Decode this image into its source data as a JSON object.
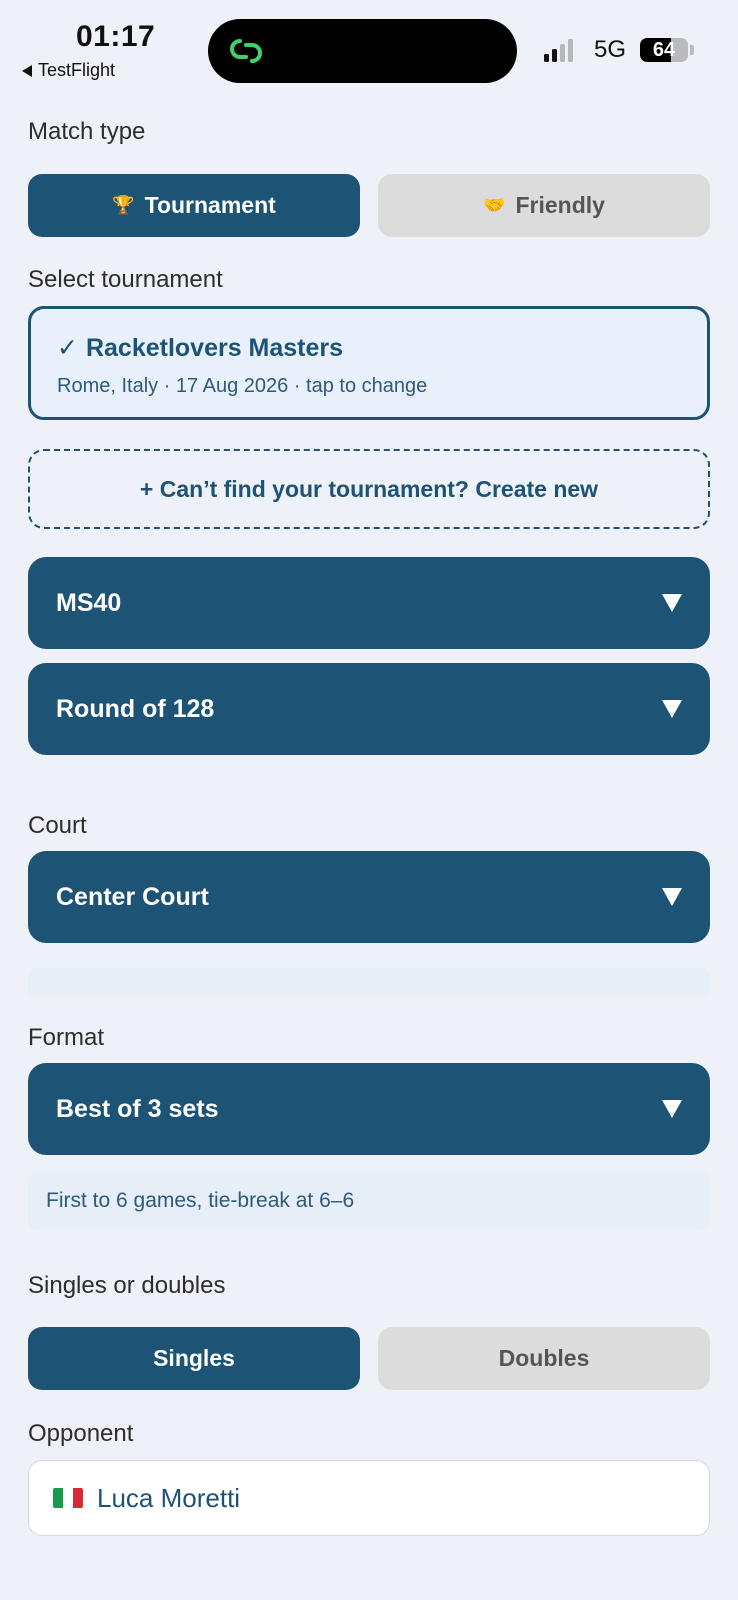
{
  "status_bar": {
    "time": "01:17",
    "back_app": "TestFlight",
    "network": "5G",
    "battery": "64",
    "battery_level": 0.64
  },
  "match_type": {
    "label": "Match type",
    "options": [
      {
        "label": "Tournament",
        "icon": "trophy-icon",
        "selected": true
      },
      {
        "label": "Friendly",
        "icon": "handshake-icon",
        "selected": false
      }
    ]
  },
  "select_tournament": {
    "label": "Select tournament",
    "selected_name": "Racketlovers Masters",
    "selected_meta": "Rome, Italy · 17 Aug 2026  · tap to change",
    "create_new": "+ Can’t find your tournament? Create new"
  },
  "category": {
    "value": "MS40"
  },
  "round": {
    "value": "Round of 128"
  },
  "court": {
    "label": "Court",
    "value": "Center Court"
  },
  "format": {
    "label": "Format",
    "value": "Best of 3 sets",
    "hint": "First to 6 games, tie-break at 6–6"
  },
  "singles_doubles": {
    "label": "Singles or doubles",
    "options": [
      {
        "label": "Singles",
        "selected": true
      },
      {
        "label": "Doubles",
        "selected": false
      }
    ]
  },
  "opponent": {
    "label": "Opponent",
    "name": "Luca Moretti",
    "flag": "italy-flag-icon"
  },
  "colors": {
    "primary": "#1d5375",
    "background": "#eef2f8",
    "inactive": "#dcdcdc"
  }
}
